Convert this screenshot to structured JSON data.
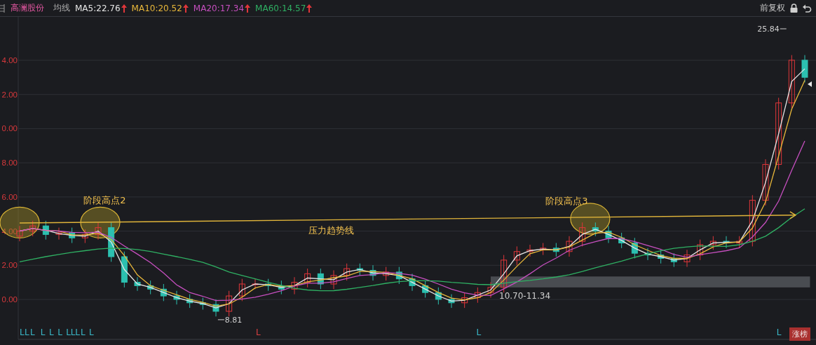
{
  "header": {
    "stock_name": "高澜股份",
    "indicator": "均线",
    "adjustment": "前复权",
    "moving_averages": [
      {
        "label": "MA5:22.76",
        "color": "#e6e6e6"
      },
      {
        "label": "MA10:20.52",
        "color": "#e8b73a"
      },
      {
        "label": "MA20:17.34",
        "color": "#c64fbf"
      },
      {
        "label": "MA60:14.57",
        "color": "#2fb063"
      }
    ]
  },
  "chart": {
    "axis_labels": [
      "4.00",
      "2.00",
      "0.00",
      "8.00",
      "6.00",
      "4.00",
      "2.00",
      "0.00"
    ],
    "annotations": [
      "阶段高点2",
      "阶段高点3",
      "压力趋势线",
      "10.70-11.34",
      "25.84",
      "8.81"
    ],
    "signal_markers": [
      {
        "text": "L",
        "color": "#3ab8c8"
      },
      {
        "text": "L",
        "color": "#3ab8c8"
      },
      {
        "text": "L",
        "color": "#3ab8c8"
      },
      {
        "text": "L",
        "color": "#3ab8c8"
      },
      {
        "text": "L",
        "color": "#3ab8c8"
      },
      {
        "text": "L",
        "color": "#3ab8c8"
      },
      {
        "text": "L",
        "color": "#3ab8c8"
      },
      {
        "text": "L",
        "color": "#3ab8c8"
      },
      {
        "text": "L",
        "color": "#3ab8c8"
      },
      {
        "text": "L",
        "color": "#3ab8c8"
      },
      {
        "text": "L",
        "color": "#3ab8c8"
      },
      {
        "text": "L",
        "color": "#d94040"
      },
      {
        "text": "L",
        "color": "#3ab8c8"
      },
      {
        "text": "L",
        "color": "#3ab8c8"
      }
    ]
  },
  "badge": "涨榜"
}
